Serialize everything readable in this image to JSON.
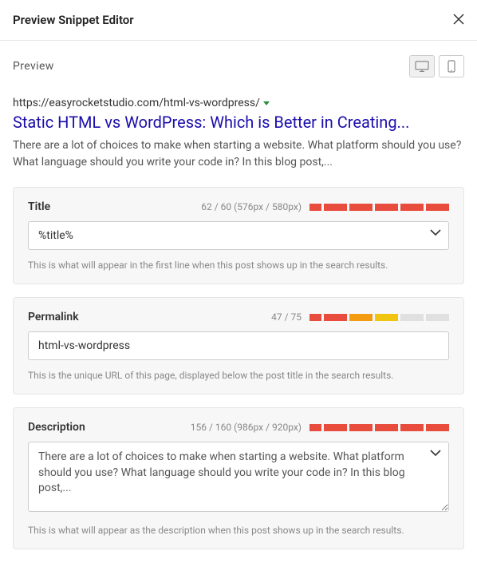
{
  "header": {
    "title": "Preview Snippet Editor"
  },
  "preview": {
    "label": "Preview",
    "url": "https://easyrocketstudio.com/html-vs-wordpress/",
    "title": "Static HTML vs WordPress: Which is Better in Creating...",
    "description": "There are a lot of choices to make when starting a website. What platform should you use? What language should you write your code in? In this blog post,..."
  },
  "title_field": {
    "label": "Title",
    "stats": "62 / 60 (576px / 580px)",
    "value": "%title%",
    "help": "This is what will appear in the first line when this post shows up in the search results."
  },
  "permalink_field": {
    "label": "Permalink",
    "stats": "47 / 75",
    "value": "html-vs-wordpress",
    "help": "This is the unique URL of this page, displayed below the post title in the search results."
  },
  "description_field": {
    "label": "Description",
    "stats": "156 / 160 (986px / 920px)",
    "value": "There are a lot of choices to make when starting a website. What platform should you use? What language should you write your code in? In this blog post,...",
    "help": "This is what will appear as the description when this post shows up in the search results."
  }
}
